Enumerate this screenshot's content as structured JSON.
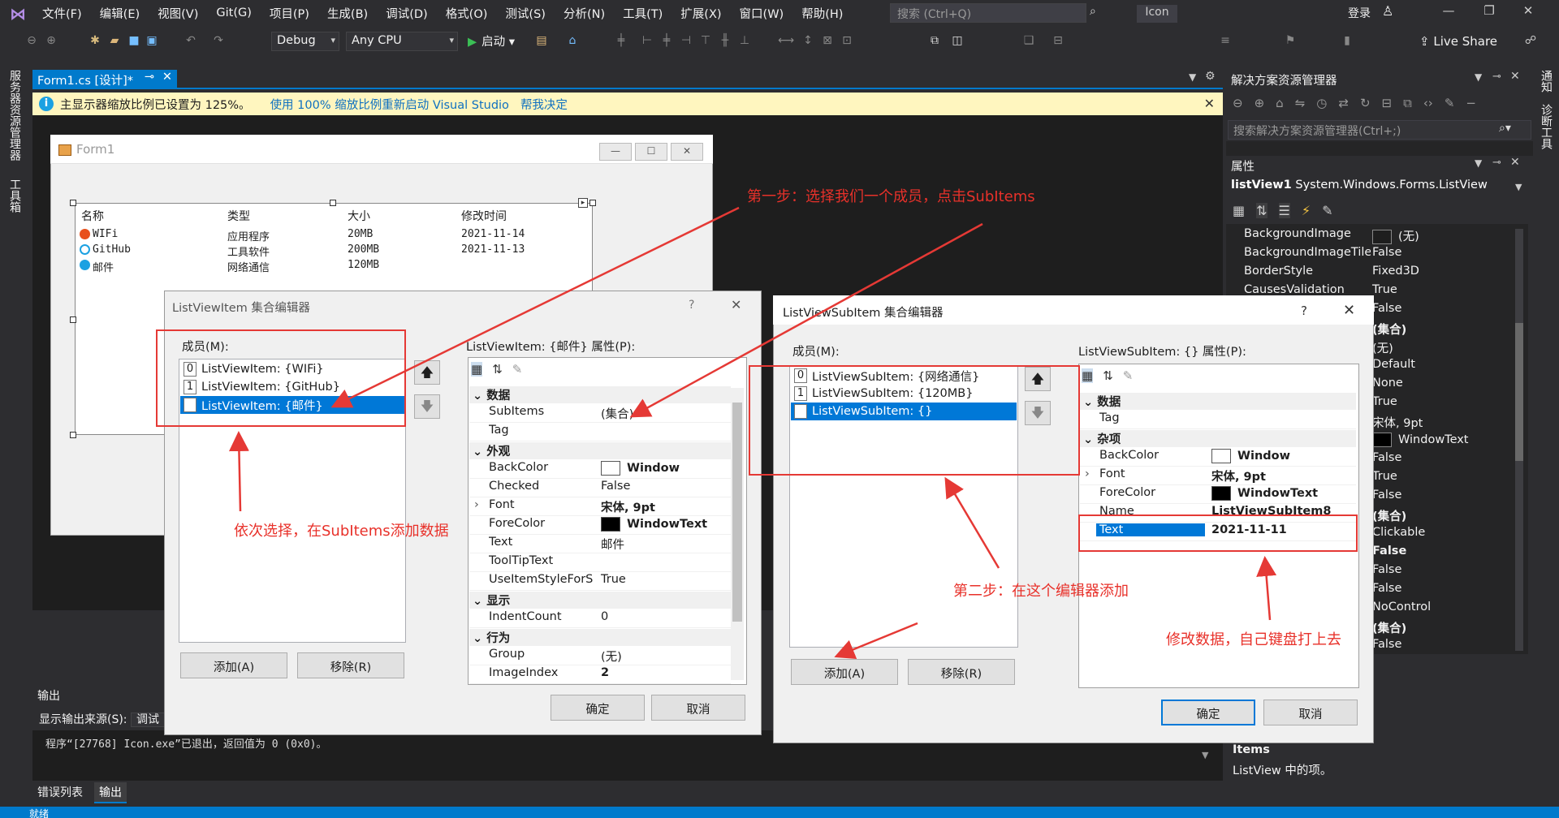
{
  "menubar": {
    "items": [
      "文件(F)",
      "编辑(E)",
      "视图(V)",
      "Git(G)",
      "项目(P)",
      "生成(B)",
      "调试(D)",
      "格式(O)",
      "测试(S)",
      "分析(N)",
      "工具(T)",
      "扩展(X)",
      "窗口(W)",
      "帮助(H)"
    ],
    "search_placeholder": "搜索 (Ctrl+Q)",
    "app_name": "Icon",
    "login": "登录"
  },
  "toolbar": {
    "config": "Debug",
    "platform": "Any CPU",
    "start": "启动",
    "live_share": "Live Share"
  },
  "left_strip": [
    "服务器资源管理器",
    "工具箱"
  ],
  "right_strip": [
    "通知",
    "诊断工具"
  ],
  "doc_tab": {
    "label": "Form1.cs [设计]*"
  },
  "infobar": {
    "message": "主显示器缩放比例已设置为 125%。",
    "link1": "使用 100% 缩放比例重新启动 Visual Studio",
    "link2": "帮我决定"
  },
  "form1": {
    "title": "Form1",
    "columns": [
      "名称",
      "类型",
      "大小",
      "修改时间"
    ],
    "rows": [
      {
        "name": "WIFi",
        "type": "应用程序",
        "size": "20MB",
        "time": "2021-11-14"
      },
      {
        "name": "GitHub",
        "type": "工具软件",
        "size": "200MB",
        "time": "2021-11-13"
      },
      {
        "name": "邮件",
        "type": "网络通信",
        "size": "120MB",
        "time": ""
      }
    ]
  },
  "dialog1": {
    "title": "ListViewItem 集合编辑器",
    "help": "?",
    "members_label": "成员(M):",
    "items": [
      {
        "idx": "0",
        "label": "ListViewItem: {WIFi}"
      },
      {
        "idx": "1",
        "label": "ListViewItem: {GitHub}"
      },
      {
        "idx": "2",
        "label": "ListViewItem: {邮件}"
      }
    ],
    "props_label": "ListViewItem: {邮件} 属性(P):",
    "add": "添加(A)",
    "remove": "移除(R)",
    "ok": "确定",
    "cancel": "取消",
    "props": [
      {
        "cat": "数据"
      },
      {
        "name": "SubItems",
        "value": "(集合)"
      },
      {
        "name": "Tag",
        "value": ""
      },
      {
        "cat": "外观"
      },
      {
        "name": "BackColor",
        "value": "Window",
        "swatch": "#ffffff",
        "bold": true
      },
      {
        "name": "Checked",
        "value": "False"
      },
      {
        "name": "Font",
        "value": "宋体, 9pt",
        "bold": true,
        "expand": true
      },
      {
        "name": "ForeColor",
        "value": "WindowText",
        "swatch": "#000000",
        "bold": true
      },
      {
        "name": "Text",
        "value": "邮件"
      },
      {
        "name": "ToolTipText",
        "value": ""
      },
      {
        "name": "UseItemStyleForS",
        "value": "True"
      },
      {
        "cat": "显示"
      },
      {
        "name": "IndentCount",
        "value": "0"
      },
      {
        "cat": "行为"
      },
      {
        "name": "Group",
        "value": "(无)"
      },
      {
        "name": "ImageIndex",
        "value": "2",
        "bold": true
      }
    ]
  },
  "dialog2": {
    "title": "ListViewSubItem 集合编辑器",
    "help": "?",
    "members_label": "成员(M):",
    "items": [
      {
        "idx": "0",
        "label": "ListViewSubItem: {网络通信}"
      },
      {
        "idx": "1",
        "label": "ListViewSubItem: {120MB}"
      },
      {
        "idx": "2",
        "label": "ListViewSubItem: {}"
      }
    ],
    "props_label": "ListViewSubItem: {} 属性(P):",
    "add": "添加(A)",
    "remove": "移除(R)",
    "ok": "确定",
    "cancel": "取消",
    "props": [
      {
        "cat": "数据"
      },
      {
        "name": "Tag",
        "value": ""
      },
      {
        "cat": "杂项"
      },
      {
        "name": "BackColor",
        "value": "Window",
        "swatch": "#ffffff",
        "bold": true
      },
      {
        "name": "Font",
        "value": "宋体, 9pt",
        "bold": true,
        "expand": true
      },
      {
        "name": "ForeColor",
        "value": "WindowText",
        "swatch": "#000000",
        "bold": true
      },
      {
        "name": "Name",
        "value": "ListViewSubItem8",
        "bold": true
      },
      {
        "name": "Text",
        "value": "2021-11-11",
        "bold": true,
        "selected": true
      }
    ]
  },
  "annotations": {
    "step1": "第一步：选择我们一个成员，点击SubItems",
    "select_hint": "依次选择，在SubItems添加数据",
    "step2": "第二步：在这个编辑器添加",
    "modify": "修改数据，自己键盘打上去"
  },
  "solution_explorer": {
    "title": "解决方案资源管理器",
    "search_placeholder": "搜索解决方案资源管理器(Ctrl+;)"
  },
  "properties": {
    "title": "属性",
    "object_name": "listView1",
    "object_type": "System.Windows.Forms.ListView",
    "rows": [
      {
        "name": "BackgroundImage",
        "value": "(无)",
        "swatch": "#1e1e1e"
      },
      {
        "name": "BackgroundImageTile",
        "value": "False"
      },
      {
        "name": "BorderStyle",
        "value": "Fixed3D"
      },
      {
        "name": "CausesValidation",
        "value": "True"
      },
      {
        "name": "",
        "value": "False"
      },
      {
        "name": "",
        "value": "(集合)",
        "bold": true
      },
      {
        "name": "",
        "value": "(无)"
      },
      {
        "name": "",
        "value": "Default"
      },
      {
        "name": "",
        "value": "None"
      },
      {
        "name": "",
        "value": "True"
      },
      {
        "name": "",
        "value": "宋体, 9pt"
      },
      {
        "name": "",
        "value": "WindowText",
        "swatch": "#000000"
      },
      {
        "name": "",
        "value": "False"
      },
      {
        "name": "",
        "value": "True"
      },
      {
        "name": "",
        "value": "False"
      },
      {
        "name": "",
        "value": "(集合)",
        "bold": true
      },
      {
        "name": "",
        "value": "Clickable"
      },
      {
        "name": "",
        "value": "False",
        "bold": true
      },
      {
        "name": "",
        "value": "False"
      },
      {
        "name": "",
        "value": "False"
      },
      {
        "name": "",
        "value": "NoControl"
      },
      {
        "name": "",
        "value": "(集合)",
        "bold": true
      },
      {
        "name": "",
        "value": "False"
      }
    ],
    "desc_title": "Items",
    "desc": "ListView 中的项。"
  },
  "output": {
    "title": "输出",
    "source_label": "显示输出来源(S):",
    "source_value": "调试",
    "text": "程序“[27768] Icon.exe”已退出，返回值为 0 (0x0)。",
    "tab_errors": "错误列表",
    "tab_output": "输出"
  },
  "status": {
    "text": "就绪"
  },
  "colors": {
    "accent": "#007acc",
    "annotation": "#e8312a",
    "selection": "#0078d7"
  }
}
